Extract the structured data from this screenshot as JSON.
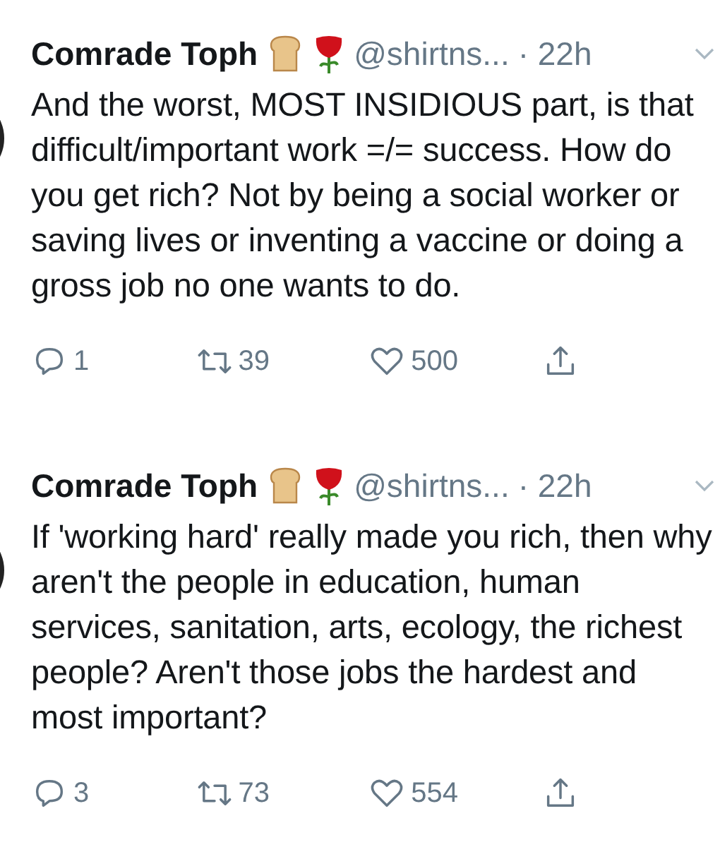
{
  "tweets": [
    {
      "name": "Comrade Toph",
      "handle": "@shirtns...",
      "time": "· 22h",
      "text": "And the worst, MOST INSIDIOUS part, is that difficult/important work =/= success. How do you get rich? Not by being a social worker or saving lives or inventing a vaccine or doing a gross job no one wants to do.",
      "replies": "1",
      "retweets": "39",
      "likes": "500"
    },
    {
      "name": "Comrade Toph",
      "handle": "@shirtns...",
      "time": "· 22h",
      "text": "If 'working hard' really made you rich, then why aren't the people in education, human services, sanitation, arts, ecology, the richest people? Aren't those jobs the hardest and most important?",
      "replies": "3",
      "retweets": "73",
      "likes": "554"
    }
  ]
}
